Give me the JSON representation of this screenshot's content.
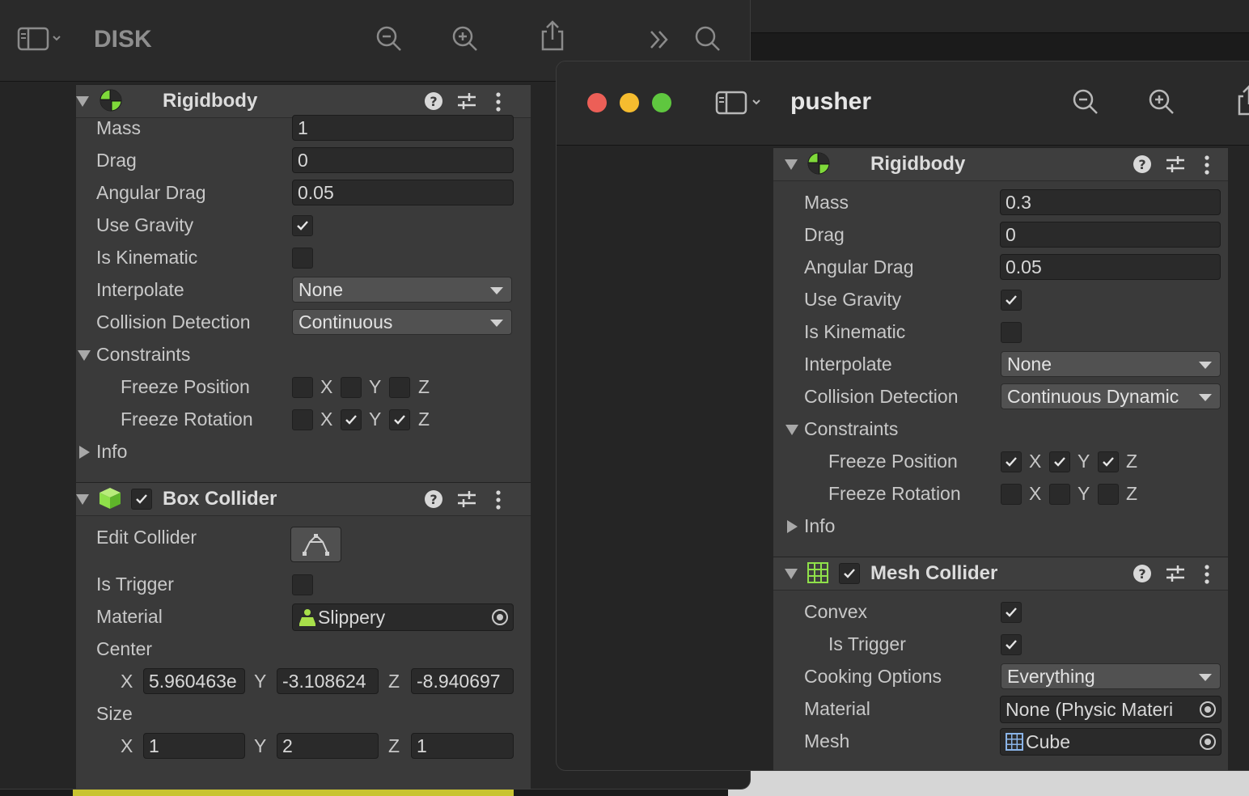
{
  "left_window": {
    "title": "DISK",
    "rigidbody": {
      "title": "Rigidbody",
      "mass_label": "Mass",
      "mass": "1",
      "drag_label": "Drag",
      "drag": "0",
      "angular_drag_label": "Angular Drag",
      "angular_drag": "0.05",
      "use_gravity_label": "Use Gravity",
      "use_gravity": true,
      "is_kinematic_label": "Is Kinematic",
      "is_kinematic": false,
      "interpolate_label": "Interpolate",
      "interpolate": "None",
      "collision_detection_label": "Collision Detection",
      "collision_detection": "Continuous",
      "constraints_label": "Constraints",
      "freeze_position_label": "Freeze Position",
      "freeze_position": {
        "x": false,
        "y": false,
        "z": false
      },
      "freeze_rotation_label": "Freeze Rotation",
      "freeze_rotation": {
        "x": false,
        "y": true,
        "z": true
      },
      "info_label": "Info"
    },
    "box_collider": {
      "title": "Box Collider",
      "enabled": true,
      "edit_collider_label": "Edit Collider",
      "is_trigger_label": "Is Trigger",
      "is_trigger": false,
      "material_label": "Material",
      "material": "Slippery",
      "center_label": "Center",
      "center": {
        "x": "5.960463e",
        "y": "-3.108624",
        "z": "-8.940697"
      },
      "size_label": "Size",
      "size": {
        "x": "1",
        "y": "2",
        "z": "1"
      }
    }
  },
  "right_window": {
    "title": "pusher",
    "rigidbody": {
      "title": "Rigidbody",
      "mass_label": "Mass",
      "mass": "0.3",
      "drag_label": "Drag",
      "drag": "0",
      "angular_drag_label": "Angular Drag",
      "angular_drag": "0.05",
      "use_gravity_label": "Use Gravity",
      "use_gravity": true,
      "is_kinematic_label": "Is Kinematic",
      "is_kinematic": false,
      "interpolate_label": "Interpolate",
      "interpolate": "None",
      "collision_detection_label": "Collision Detection",
      "collision_detection": "Continuous Dynamic",
      "constraints_label": "Constraints",
      "freeze_position_label": "Freeze Position",
      "freeze_position": {
        "x": true,
        "y": true,
        "z": true
      },
      "freeze_rotation_label": "Freeze Rotation",
      "freeze_rotation": {
        "x": false,
        "y": false,
        "z": false
      },
      "info_label": "Info"
    },
    "mesh_collider": {
      "title": "Mesh Collider",
      "enabled": true,
      "convex_label": "Convex",
      "convex": true,
      "is_trigger_label": "Is Trigger",
      "is_trigger": true,
      "cooking_options_label": "Cooking Options",
      "cooking_options": "Everything",
      "material_label": "Material",
      "material": "None (Physic Materi",
      "mesh_label": "Mesh",
      "mesh": "Cube"
    }
  },
  "axes": {
    "x": "X",
    "y": "Y",
    "z": "Z"
  },
  "colors": {
    "traffic_close": "#ec5f57",
    "traffic_minimize": "#f5bc2f",
    "traffic_zoom": "#5fc73f",
    "rigidbody_icon": "#7fd93a",
    "collider_icon": "#8fe04a"
  },
  "icons": [
    "sidebar-toggle-icon",
    "zoom-out-icon",
    "zoom-in-icon",
    "share-icon",
    "chevron-double-right-icon",
    "search-icon",
    "help-icon",
    "preset-sliders-icon",
    "more-vertical-icon"
  ]
}
